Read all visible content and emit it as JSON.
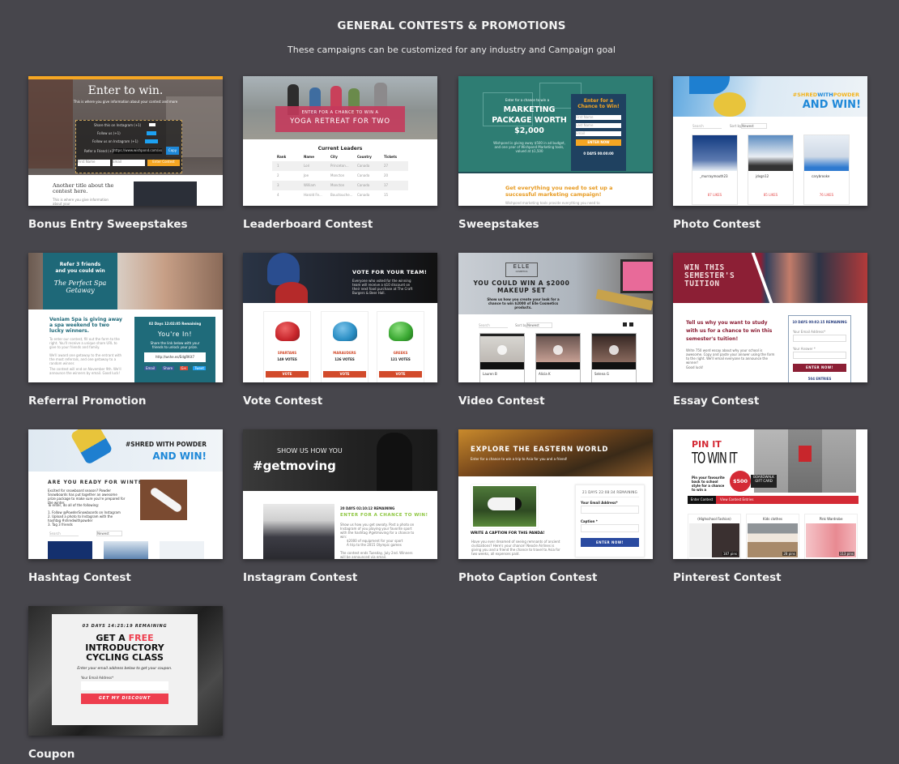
{
  "header": {
    "title": "GENERAL CONTESTS & PROMOTIONS",
    "subtitle": "These campaigns can be customized for any industry and Campaign goal"
  },
  "templates": [
    {
      "name": "Bonus Entry Sweepstakes",
      "preview": {
        "headline": "Enter to win.",
        "tagline": "This is where you give information about your contest and more",
        "actions": [
          "Share this on Instagram (+1)",
          "Follow us (+1)",
          "Follow us on Instagram (+1)",
          "Refer a Friend (+1)"
        ],
        "referral_url": "https://www.wishpond.com/xxx",
        "copy_button": "Copy",
        "first_name_placeholder": "First Name",
        "email_placeholder": "Email",
        "submit": "Enter Contest",
        "subheading": "Another title about the contest here.",
        "body": "This is where you give information about your",
        "accent": "#f5a623"
      }
    },
    {
      "name": "Leaderboard Contest",
      "preview": {
        "banner_small": "ENTER FOR A CHANCE TO WIN A",
        "banner_large": "YOGA RETREAT FOR TWO",
        "table_title": "Current Leaders",
        "columns": [
          "Rank",
          "Name",
          "City",
          "Country",
          "Tickets"
        ],
        "rows": [
          [
            "1",
            "Lori",
            "Princeton...",
            "Canada",
            "27"
          ],
          [
            "2",
            "Joe",
            "Moncton",
            "Canada",
            "20"
          ],
          [
            "3",
            "William",
            "Moncton",
            "Canada",
            "17"
          ],
          [
            "4",
            "Harold Fe...",
            "Bouctouche...",
            "Canada",
            "15"
          ]
        ],
        "accent": "#c44a6a"
      }
    },
    {
      "name": "Sweepstakes",
      "preview": {
        "intro": "Enter for a chance to win a",
        "headline": "MARKETING PACKAGE WORTH $2,000",
        "body": "Wishpond is giving away $500 in ad budget, and one year of Wishpond Marketing tools, valued at $1,500",
        "form_title": "Enter for a Chance to Win!",
        "fields": [
          "First Name",
          "Last Name",
          "Email"
        ],
        "submit": "ENTER NOW",
        "countdown": "0 DAYS 00:00:00",
        "subheading": "Get everything you need to set up a successful marketing campaign!",
        "body2": "Wishpond marketing tools provide everything you need to",
        "accent": "#f5a623",
        "bg": "#2e7d73"
      }
    },
    {
      "name": "Photo Contest",
      "preview": {
        "hashtag_parts": [
          "#SHRED",
          "WITH",
          "POWDER"
        ],
        "headline": "AND WIN!",
        "search_placeholder": "Search",
        "sort_label": "Sort by:",
        "sort_value": "Newest",
        "entries": [
          {
            "user": "_murraymouth23",
            "likes": "87 LIKES"
          },
          {
            "user": "jdxgn12",
            "likes": "85 LIKES"
          },
          {
            "user": "carybrooke",
            "likes": "76 LIKES"
          }
        ],
        "accent": "#1e88d8"
      }
    },
    {
      "name": "Referral Promotion",
      "preview": {
        "banner_line1": "Refer 3 friends and you could win",
        "banner_script": "The Perfect Spa Getaway",
        "heading": "Veniam Spa is giving away a spa weekend to two lucky winners.",
        "body": [
          "To enter our contest, fill out the form to the right. You'll receive a unique share URL to give to your friends and family.",
          "We'll award one getaway to the entrant with the most referrals, and one getaway to a random winner.",
          "The contest will end on November 9th. We'll announce the winners by email. Good luck!"
        ],
        "countdown": "02 Days 12:02:05 Remaining",
        "confirm": "You're In!",
        "share_text": "Share the link below with your friends to unlock your prize.",
        "share_url": "http://wshe.es/EdgRKit7",
        "share_buttons": [
          "Email",
          "Share",
          "G+",
          "Tweet"
        ],
        "accent": "#1f6b7a"
      }
    },
    {
      "name": "Vote Contest",
      "preview": {
        "headline": "VOTE FOR YOUR TEAM!",
        "body": "Everyone who voted for the winning team will receive a $10 discount on their next food purchase at The Craft Burgers & Beer Hall.",
        "teams": [
          {
            "name": "SPARTANS",
            "votes": "149 VOTES",
            "color": "#c8262c"
          },
          {
            "name": "MARAUDERS",
            "votes": "126 VOTES",
            "color": "#2a8ec4"
          },
          {
            "name": "GREEKS",
            "votes": "121 VOTES",
            "color": "#3aa832"
          }
        ],
        "vote_button": "VOTE",
        "accent": "#d24a2a"
      }
    },
    {
      "name": "Video Contest",
      "preview": {
        "brand": "ELLE",
        "brand_sub": "COSMETICS",
        "headline": "YOU COULD WIN A $2000 MAKEUP SET",
        "body": "Show us how you create your look for a chance to win $2000 of Elle Cosmetics products.",
        "search_placeholder": "Search",
        "sort_label": "Sort by:",
        "sort_value": "Newest",
        "entries": [
          "Lauren B",
          "Alicia K",
          "Selena G"
        ]
      }
    },
    {
      "name": "Essay Contest",
      "preview": {
        "banner": "WIN THIS SEMESTER'S TUITION",
        "heading": "Tell us why you want to study with us for a chance to win this semester's tuition!",
        "body": "Write 750 word essay about why your school is awesome. Copy and paste your answer using the form to the right. We'll email everyone to announce the winner!",
        "sign_off": "Good luck!",
        "countdown": "10 DAYS 00:02:15 REMAINING",
        "fields": [
          "Your Email Address*",
          "Your Answer *"
        ],
        "submit": "ENTER NOW!",
        "entries": "504 ENTRIES",
        "accent": "#8c1f35"
      }
    },
    {
      "name": "Hashtag Contest",
      "preview": {
        "hashtag": "#SHRED WITH POWDER",
        "headline": "AND WIN!",
        "heading": "ARE YOU READY FOR WINTER?",
        "body": "Excited for snowboard season? Powder Snowboards has put together an awesome prize package to make sure you're prepared for the winter.",
        "steps": [
          "To enter, do all of the following:",
          "1. Follow @PowderSnowboards on Instagram",
          "2. Upload a photo to Instagram with the hashtag #shredwithpowder",
          "3. Tag 3 friends"
        ],
        "search_placeholder": "Search",
        "sort_value": "Newest",
        "accent": "#1e88d8"
      }
    },
    {
      "name": "Instagram Contest",
      "preview": {
        "intro": "SHOW US HOW YOU",
        "hashtag": "#getmoving",
        "countdown": "20 DAYS 02:10:12 REMAINING",
        "heading": "ENTER FOR A CHANCE TO WIN!",
        "body": "Show us how you get sweaty. Post a photo on Instagram of you playing your favorite sport with the hashtag #getmoving for a chance to win:",
        "prizes": [
          "$2000 of equipment for your sport",
          "A trip to the 2015 Olympic games"
        ],
        "footer": "The contest ends Tuesday, July 2nd. Winners will be announced via email.",
        "accent": "#8dc63f"
      }
    },
    {
      "name": "Photo Caption Contest",
      "preview": {
        "headline": "EXPLORE THE EASTERN WORLD",
        "subheadline": "Enter for a chance to win a trip to Asia for you and a friend!",
        "prompt": "WRITE A CAPTION FOR THIS PANDA!",
        "body": "Have you ever dreamed of seeing remnants of ancient civilizations? Here's your chance! Neocle Airlines is giving you and a friend the chance to travel to Asia for two weeks, all expenses paid.",
        "countdown": "21 DAYS 22:08:34 REMAINING",
        "fields": [
          "Your Email Address*",
          "Caption *"
        ],
        "submit": "ENTER NOW!",
        "accent": "#2a4aa0"
      }
    },
    {
      "name": "Pinterest Contest",
      "preview": {
        "headline_top": "PIN IT",
        "headline_bottom": "TO WIN IT",
        "body": "Pin your favourite back to school style for a chance to win a",
        "badge": "$500",
        "gift_card": "BOARDWALK GIFT CARD",
        "tabs": [
          "Enter Contest",
          "View Contest Entries"
        ],
        "boards": [
          {
            "title": "(Highschool Fashion)",
            "pins": "187 pins"
          },
          {
            "title": "Kids clothes",
            "pins": "28 pins"
          },
          {
            "title": "Pink Wardrobe",
            "pins": "113 pins"
          }
        ],
        "accent": "#d42a35"
      }
    },
    {
      "name": "Coupon",
      "preview": {
        "countdown": "03 DAYS 14:25:19 REMAINING",
        "headline_pre": "GET A ",
        "headline_accent": "FREE",
        "headline_rest": "INTRODUCTORY CYCLING CLASS",
        "body": "Enter your email address below to get your coupon.",
        "field_label": "Your Email Address*",
        "submit": "GET MY DISCOUNT",
        "accent": "#ee3e4e"
      }
    }
  ]
}
